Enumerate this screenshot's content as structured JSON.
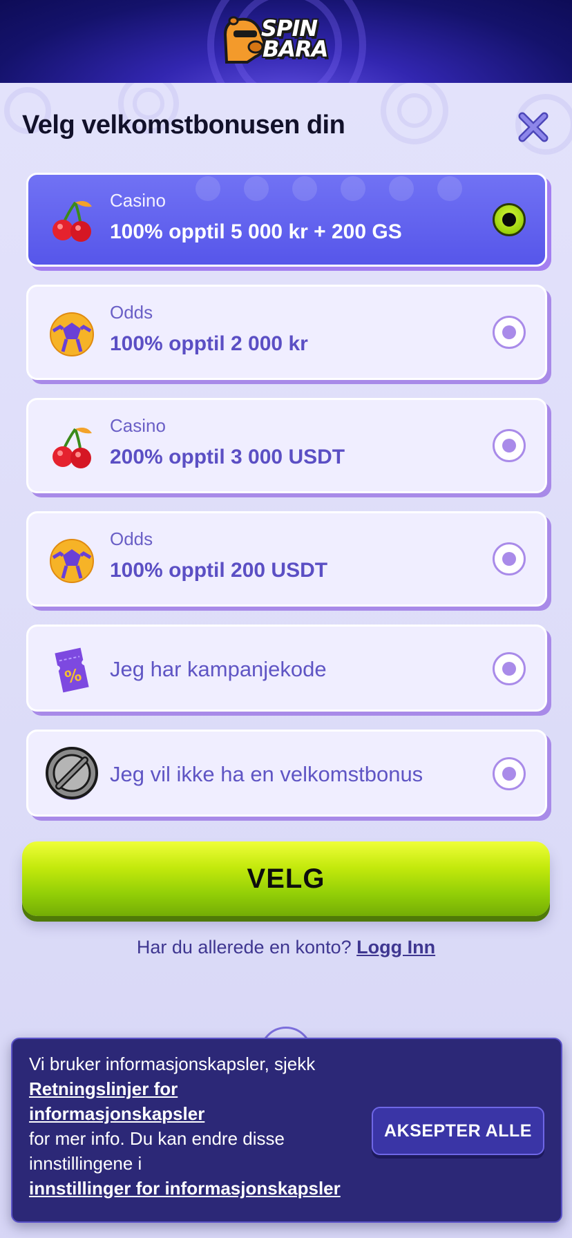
{
  "header": {
    "logo_line1": "SPIN",
    "logo_line2": "BARA"
  },
  "modal": {
    "title": "Velg velkomstbonusen din",
    "options": [
      {
        "category": "Casino",
        "value": "100% opptil 5 000 kr + 200 GS",
        "icon": "cherries-icon",
        "selected": true
      },
      {
        "category": "Odds",
        "value": "100% opptil 2 000 kr",
        "icon": "soccer-ball-icon",
        "selected": false
      },
      {
        "category": "Casino",
        "value": "200% opptil 3 000 USDT",
        "icon": "cherries-icon",
        "selected": false
      },
      {
        "category": "Odds",
        "value": "100% opptil 200 USDT",
        "icon": "soccer-ball-icon",
        "selected": false
      },
      {
        "label": "Jeg har kampanjekode",
        "icon": "promo-ticket-icon",
        "selected": false
      },
      {
        "label": "Jeg vil ikke ha en velkomstbonus",
        "icon": "no-bonus-icon",
        "selected": false
      }
    ],
    "cta_label": "VELG",
    "login_prompt": "Har du allerede en konto?",
    "login_link": "Logg Inn"
  },
  "cookie_banner": {
    "text1": "Vi bruker informasjonskapsler, sjekk",
    "link1": "Retningslinjer for informasjonskapsler",
    "text2": "for mer info. Du kan endre disse innstillingene i",
    "link2": "innstillinger for informasjonskapsler",
    "accept_label": "AKSEPTER ALLE"
  },
  "colors": {
    "accent_green": "#9cd30c",
    "selected_card": "#5f60ee",
    "card_bg": "#f0eeff",
    "cookie_bg": "#2c2877"
  }
}
